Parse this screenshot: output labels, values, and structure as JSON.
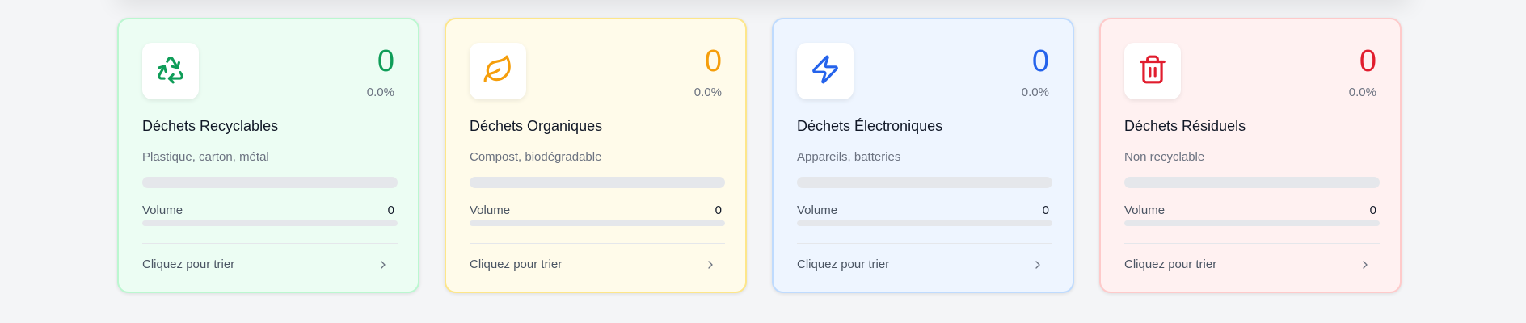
{
  "volume_label": "Volume",
  "action_label": "Cliquez pour trier",
  "cards": [
    {
      "icon": "recycle-icon",
      "count": "0",
      "percent": "0.0%",
      "title": "Déchets Recyclables",
      "subtitle": "Plastique, carton, métal",
      "volume": "0",
      "fill_fraction": 0,
      "accent": "#0f9d58",
      "bg": "#ecfdf3",
      "border": "#bbf7d0"
    },
    {
      "icon": "leaf-icon",
      "count": "0",
      "percent": "0.0%",
      "title": "Déchets Organiques",
      "subtitle": "Compost, biodégradable",
      "volume": "0",
      "fill_fraction": 0,
      "accent": "#f59e0b",
      "bg": "#fffbea",
      "border": "#fde68a"
    },
    {
      "icon": "lightning-icon",
      "count": "0",
      "percent": "0.0%",
      "title": "Déchets Électroniques",
      "subtitle": "Appareils, batteries",
      "volume": "0",
      "fill_fraction": 0,
      "accent": "#2563eb",
      "bg": "#eef5ff",
      "border": "#bfdbfe"
    },
    {
      "icon": "trash-icon",
      "count": "0",
      "percent": "0.0%",
      "title": "Déchets Résiduels",
      "subtitle": "Non recyclable",
      "volume": "0",
      "fill_fraction": 0,
      "accent": "#e11d2e",
      "bg": "#fff1f1",
      "border": "#fecaca"
    }
  ]
}
